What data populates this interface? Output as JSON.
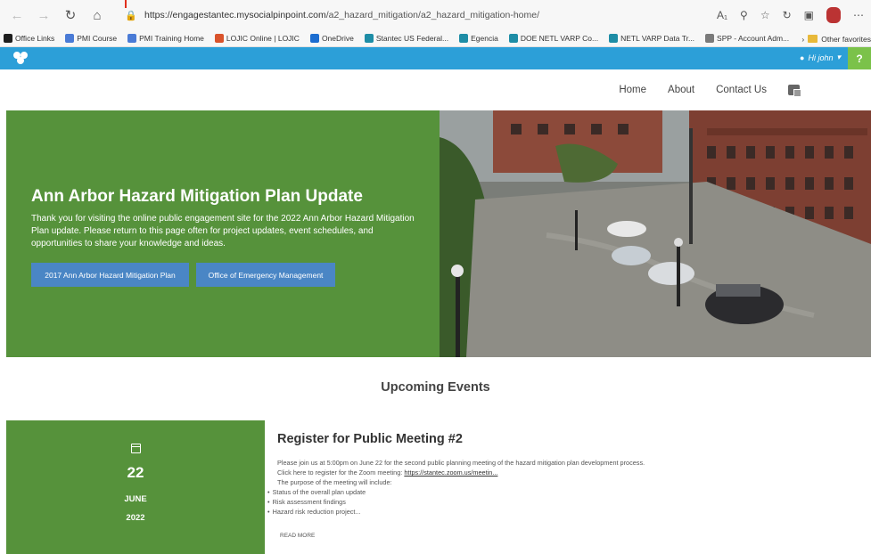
{
  "browser": {
    "url_domain": "https://engagestantec.mysocialpinpoint.com",
    "url_path": "/a2_hazard_mitigation/a2_hazard_mitigation-home/",
    "favorites": [
      {
        "label": "Office Links",
        "color": "#1e1e1e"
      },
      {
        "label": "PMI Course",
        "color": "#4a7bd6"
      },
      {
        "label": "PMI Training Home",
        "color": "#4a7bd6"
      },
      {
        "label": "LOJIC Online | LOJIC",
        "color": "#d9532b"
      },
      {
        "label": "OneDrive",
        "color": "#1c6dd0"
      },
      {
        "label": "Stantec US Federal...",
        "color": "#1e8da6"
      },
      {
        "label": "Egencia",
        "color": "#1e8da6"
      },
      {
        "label": "DOE NETL VARP Co...",
        "color": "#1e8da6"
      },
      {
        "label": "NETL VARP Data Tr...",
        "color": "#1e8da6"
      },
      {
        "label": "SPP - Account Adm...",
        "color": "#7a7a7a"
      }
    ],
    "other_favorites": "Other favorites"
  },
  "site": {
    "user_label": "Hi john",
    "help_label": "?",
    "nav": [
      "Home",
      "About",
      "Contact Us"
    ]
  },
  "hero": {
    "title": "Ann Arbor Hazard Mitigation Plan Update",
    "text": "Thank you for visiting the online public engagement site for the 2022 Ann Arbor Hazard Mitigation Plan update. Please return to this page often for project updates, event schedules, and opportunities to share your knowledge and ideas.",
    "button1": "2017 Ann Arbor Hazard Mitigation Plan",
    "button2": "Office of Emergency Management"
  },
  "upcoming_title": "Upcoming Events",
  "event": {
    "day": "22",
    "month": "JUNE",
    "year": "2022",
    "title": "Register for Public Meeting #2",
    "line1": "Please join us at 5:00pm on June 22 for the second public planning meeting of the hazard mitigation plan development process.",
    "line2_prefix": "Click here to register for the Zoom meeting: ",
    "line2_link": "https://stantec.zoom.us/meetin...",
    "line3": "The purpose of the meeting will include:",
    "bullets": [
      "Status of the overall plan update",
      "Risk assessment findings",
      "Hazard risk reduction project..."
    ],
    "read_more": "READ MORE"
  },
  "colors": {
    "site_bar": "#2c9fd8",
    "hero_green": "#56923b",
    "button_blue": "#4a86c5",
    "help_green": "#7bc24a"
  }
}
